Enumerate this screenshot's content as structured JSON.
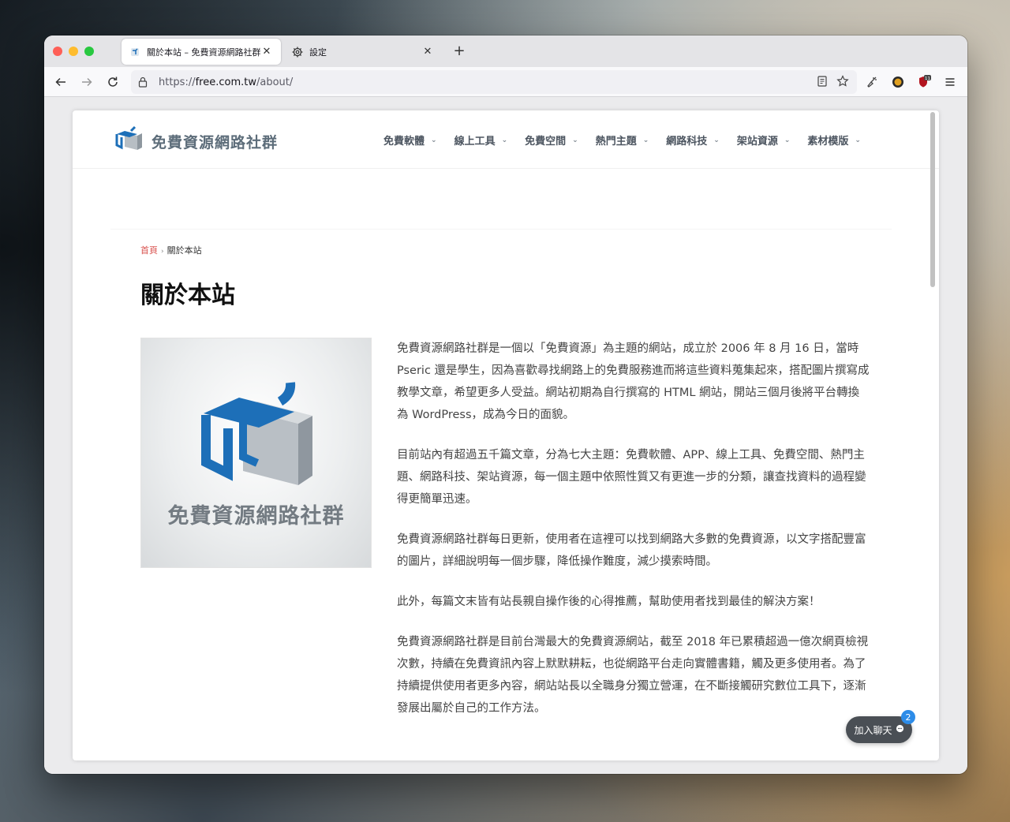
{
  "browser": {
    "tabs": [
      {
        "label": "關於本站 – 免費資源網路社群",
        "active": true
      },
      {
        "label": "設定",
        "active": false
      }
    ],
    "url_scheme": "https://",
    "url_host": "free.com.tw",
    "url_path": "/about/",
    "extension_badge": "11"
  },
  "site": {
    "name": "免費資源網路社群",
    "menu": [
      "免費軟體",
      "線上工具",
      "免費空間",
      "熱門主題",
      "網路科技",
      "架站資源",
      "素材模版"
    ]
  },
  "breadcrumb": {
    "home": "首頁",
    "separator": "›",
    "current": "關於本站"
  },
  "article": {
    "title": "關於本站",
    "image_caption": "免費資源網路社群",
    "paragraphs": [
      "免費資源網路社群是一個以「免費資源」為主題的網站，成立於 2006 年 8 月 16 日，當時 Pseric 還是學生，因為喜歡尋找網路上的免費服務進而將這些資料蒐集起來，搭配圖片撰寫成教學文章，希望更多人受益。網站初期為自行撰寫的 HTML 網站，開站三個月後將平台轉換為 WordPress，成為今日的面貌。",
      "目前站內有超過五千篇文章，分為七大主題：免費軟體、APP、線上工具、免費空間、熱門主題、網路科技、架站資源，每一個主題中依照性質又有更進一步的分類，讓查找資料的過程變得更簡單迅速。",
      "免費資源網路社群每日更新，使用者在這裡可以找到網路大多數的免費資源，以文字搭配豐富的圖片，詳細說明每一個步驟，降低操作難度，減少摸索時間。",
      "此外，每篇文末皆有站長親自操作後的心得推薦，幫助使用者找到最佳的解決方案！",
      "免費資源網路社群是目前台灣最大的免費資源網站，截至 2018 年已累積超過一億次網頁檢視次數，持續在免費資訊內容上默默耕耘，也從網路平台走向實體書籍，觸及更多使用者。為了持續提供使用者更多內容，網站站長以全職身分獨立營運，在不斷接觸研究數位工具下，逐漸發展出屬於自己的工作方法。"
    ]
  },
  "chat": {
    "label": "加入聊天",
    "badge": "2"
  },
  "colors": {
    "brand_blue": "#1d6fb8",
    "accent_red": "#d9534f",
    "chat_bg": "#4a4f55",
    "badge_blue": "#2d8ce8"
  }
}
